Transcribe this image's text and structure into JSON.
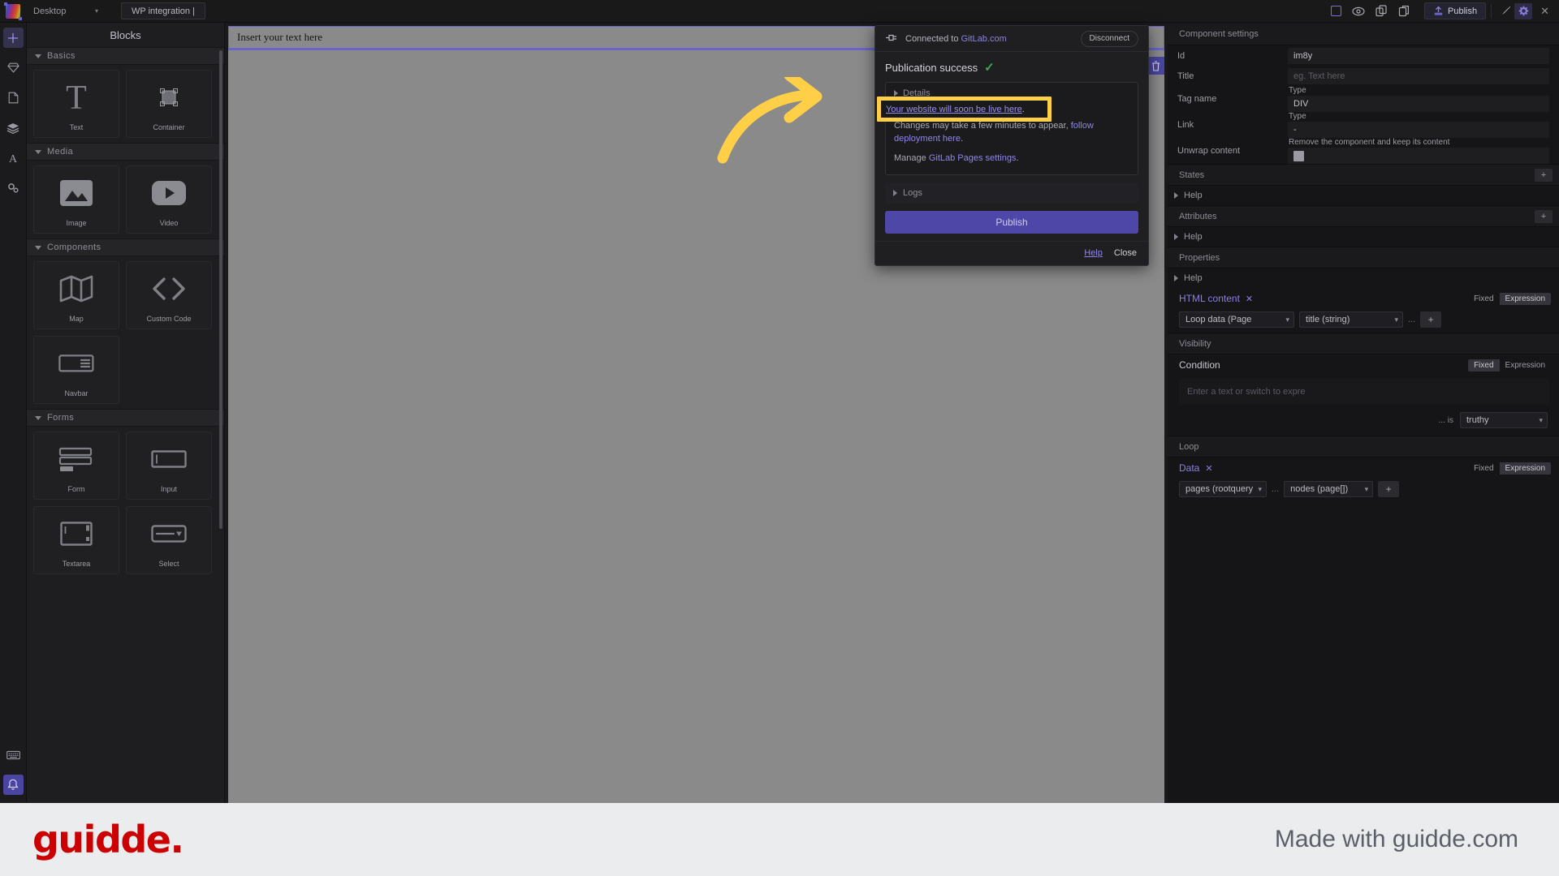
{
  "topbar": {
    "device": "Desktop",
    "device_chevron": "▾",
    "project_tab": "WP integration |",
    "publish_label": "Publish",
    "icons": [
      "frame-icon",
      "eye-icon",
      "copy-icon",
      "paste-icon",
      "upload-icon",
      "brush-icon",
      "gear-icon"
    ],
    "close": "✕"
  },
  "rail": {
    "items": [
      {
        "name": "add-icon",
        "glyph": "+"
      },
      {
        "name": "gem-icon",
        "glyph": "gem"
      },
      {
        "name": "page-icon",
        "glyph": "page"
      },
      {
        "name": "layers-icon",
        "glyph": "layers"
      },
      {
        "name": "typography-icon",
        "glyph": "A"
      },
      {
        "name": "settings-gears-icon",
        "glyph": "gears"
      }
    ],
    "bottom": [
      {
        "name": "keyboard-icon",
        "glyph": "keyboard"
      },
      {
        "name": "notifications-bell-icon",
        "glyph": "bell"
      }
    ]
  },
  "blocks": {
    "title": "Blocks",
    "sections": [
      {
        "label": "Basics",
        "tiles": [
          {
            "label": "Text",
            "icon": "text-icon"
          },
          {
            "label": "Container",
            "icon": "container-icon"
          }
        ]
      },
      {
        "label": "Media",
        "tiles": [
          {
            "label": "Image",
            "icon": "image-icon"
          },
          {
            "label": "Video",
            "icon": "video-icon"
          }
        ]
      },
      {
        "label": "Components",
        "tiles": [
          {
            "label": "Map",
            "icon": "map-icon"
          },
          {
            "label": "Custom Code",
            "icon": "code-icon"
          },
          {
            "label": "Navbar",
            "icon": "navbar-icon"
          }
        ]
      },
      {
        "label": "Forms",
        "tiles": [
          {
            "label": "Form",
            "icon": "form-icon"
          },
          {
            "label": "Input",
            "icon": "input-icon"
          },
          {
            "label": "Textarea",
            "icon": "textarea-icon"
          },
          {
            "label": "Select",
            "icon": "select-icon"
          }
        ]
      }
    ]
  },
  "canvas": {
    "text_element": "Insert your text here",
    "delete_icon": "trash-icon"
  },
  "dialog": {
    "connected_prefix": "Connected to ",
    "connected_provider": "GitLab.com",
    "disconnect": "Disconnect",
    "success_title": "Publication success",
    "success_check": "✓",
    "details_label": "Details",
    "live_link": "Your website will soon be live here",
    "live_link_period": ".",
    "changes_text": "Changes may take a few minutes to appear, ",
    "changes_link": "follow deployment here",
    "changes_period": ".",
    "manage_prefix": "Manage ",
    "manage_link": "GitLab Pages settings",
    "manage_period": ".",
    "logs_label": "Logs",
    "publish_label": "Publish",
    "help_label": "Help",
    "close_label": "Close"
  },
  "right_panel": {
    "header": "Component settings",
    "fields": [
      {
        "key": "Id",
        "value": "im8y",
        "placeholder": ""
      },
      {
        "key": "Title",
        "value": "",
        "placeholder": "eg. Text here"
      },
      {
        "key": "Tag name",
        "sub": "Type",
        "value": "DIV"
      },
      {
        "key": "Link",
        "sub": "Type",
        "value": "-"
      },
      {
        "key": "Unwrap content",
        "sub": "Remove the component and keep its content",
        "value": ""
      }
    ],
    "states": {
      "label": "States",
      "add": "+"
    },
    "attributes": {
      "label": "Attributes",
      "add": "+"
    },
    "properties": {
      "label": "Properties"
    },
    "help": "Help",
    "html_content": {
      "label": "HTML content",
      "remove": "✕",
      "mode_fixed": "Fixed",
      "mode_expression": "Expression",
      "active_mode": "Expression",
      "source": "Loop data (Page",
      "field": "title (string)",
      "ellipsis": "...",
      "add": "+"
    },
    "visibility": {
      "section": "Visibility",
      "condition_label": "Condition",
      "mode_fixed": "Fixed",
      "mode_expression": "Expression",
      "active_mode": "Fixed",
      "placeholder": "Enter a text or switch to expre",
      "is_label": "... is",
      "is_value": "truthy"
    },
    "loop": {
      "section": "Loop",
      "label": "Data",
      "remove": "✕",
      "mode_fixed": "Fixed",
      "mode_expression": "Expression",
      "active_mode": "Expression",
      "source": "pages (rootquery",
      "ellipsis": "...",
      "field": "nodes (page[])",
      "add": "+"
    }
  },
  "footer": {
    "logo": "guidde.",
    "made_with": "Made with guidde.com"
  },
  "colors": {
    "accent_purple": "#4f47a8",
    "link_purple": "#8f86e8",
    "highlight_yellow": "#ffcf47",
    "success_green": "#3fa95a",
    "brand_red": "#cc0000"
  }
}
